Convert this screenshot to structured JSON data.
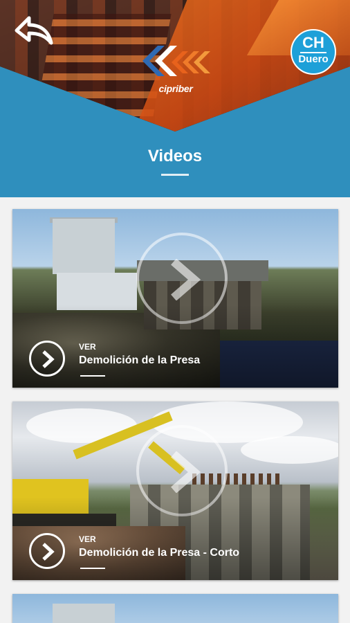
{
  "header": {
    "brand": "cipriber",
    "badge_top": "CH",
    "badge_bottom": "Duero",
    "title": "Videos",
    "accent_color": "#2f8fbd"
  },
  "videos": [
    {
      "ver_label": "VER",
      "title": "Demolición de la Presa",
      "icon": "play-chevron-icon"
    },
    {
      "ver_label": "VER",
      "title": "Demolición de la Presa - Corto",
      "icon": "play-chevron-icon"
    },
    {
      "ver_label": "",
      "title": "",
      "icon": "play-chevron-icon"
    }
  ]
}
